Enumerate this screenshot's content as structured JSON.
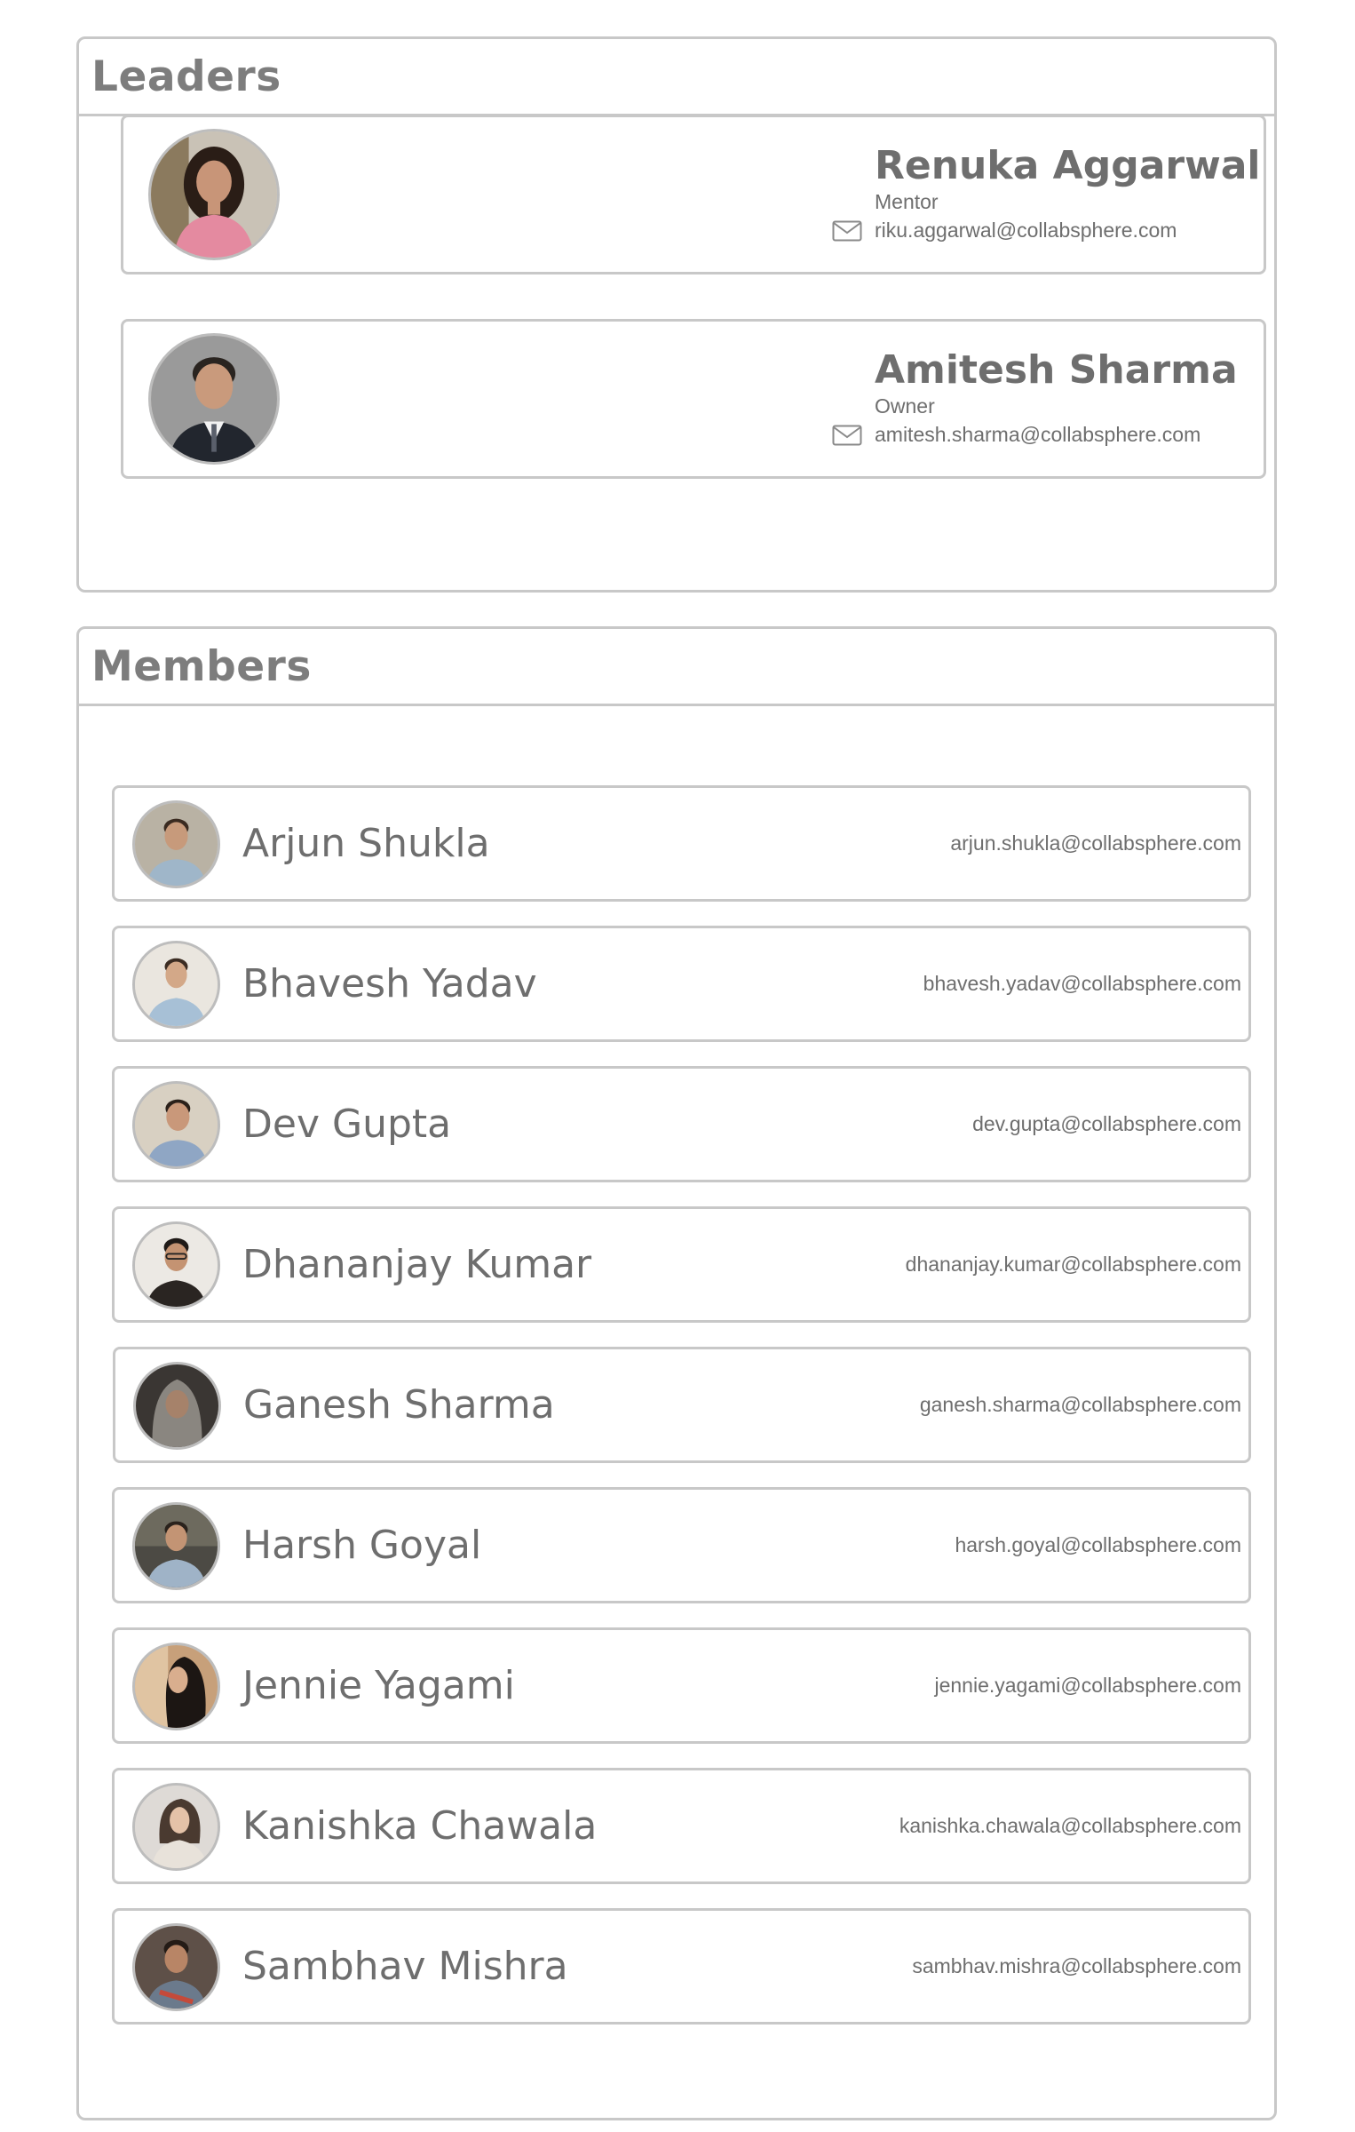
{
  "leaders": {
    "title": "Leaders",
    "items": [
      {
        "name": "Renuka Aggarwal",
        "role": "Mentor",
        "email": "riku.aggarwal@collabsphere.com"
      },
      {
        "name": "Amitesh Sharma",
        "role": "Owner",
        "email": "amitesh.sharma@collabsphere.com"
      }
    ]
  },
  "members": {
    "title": "Members",
    "items": [
      {
        "name": "Arjun Shukla",
        "email": "arjun.shukla@collabsphere.com"
      },
      {
        "name": "Bhavesh Yadav",
        "email": "bhavesh.yadav@collabsphere.com"
      },
      {
        "name": "Dev Gupta",
        "email": "dev.gupta@collabsphere.com"
      },
      {
        "name": "Dhananjay Kumar",
        "email": "dhananjay.kumar@collabsphere.com"
      },
      {
        "name": "Ganesh Sharma",
        "email": "ganesh.sharma@collabsphere.com"
      },
      {
        "name": "Harsh Goyal",
        "email": "harsh.goyal@collabsphere.com"
      },
      {
        "name": "Jennie Yagami",
        "email": "jennie.yagami@collabsphere.com"
      },
      {
        "name": "Kanishka Chawala",
        "email": "kanishka.chawala@collabsphere.com"
      },
      {
        "name": "Sambhav Mishra",
        "email": "sambhav.mishra@collabsphere.com"
      }
    ]
  },
  "icons": {
    "email": "envelope-icon",
    "avatar": "user-photo"
  },
  "colors": {
    "border": "#c8c8c8",
    "title": "#7d7d7d",
    "text": "#6e6e6e"
  }
}
